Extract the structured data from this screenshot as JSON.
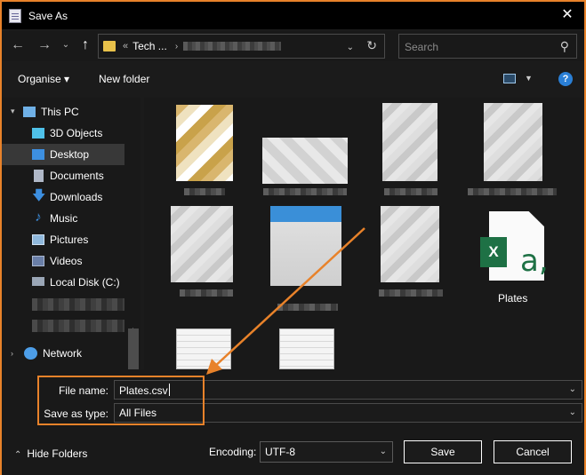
{
  "window": {
    "title": "Save As",
    "close_glyph": "✕"
  },
  "nav_buttons": {
    "back": "←",
    "forward": "→",
    "recent": "⌄",
    "up": "↑"
  },
  "address": {
    "prefix": "«",
    "segment": "Tech ...",
    "chevron": "›",
    "refresh_glyph": "↻",
    "dropdown_glyph": "⌄"
  },
  "search": {
    "placeholder": "Search",
    "icon": "search-icon",
    "glyph": "⚲"
  },
  "toolbar": {
    "organise": "Organise ▾",
    "new_folder": "New folder",
    "help": "?"
  },
  "sidebar": {
    "items": [
      {
        "label": "This PC",
        "icon": "pc-icon",
        "color": "#6fb0e6"
      },
      {
        "label": "3D Objects",
        "icon": "cube-icon",
        "color": "#4fc1e9"
      },
      {
        "label": "Desktop",
        "icon": "desktop-icon",
        "color": "#3d8fe0",
        "selected": true
      },
      {
        "label": "Documents",
        "icon": "documents-icon",
        "color": "#b0b8c8"
      },
      {
        "label": "Downloads",
        "icon": "download-icon",
        "color": "#3d8fe0"
      },
      {
        "label": "Music",
        "icon": "music-icon",
        "color": "#3d8fe0"
      },
      {
        "label": "Pictures",
        "icon": "pictures-icon",
        "color": "#8fb8dc"
      },
      {
        "label": "Videos",
        "icon": "videos-icon",
        "color": "#6a7fa8"
      },
      {
        "label": "Local Disk (C:)",
        "icon": "disk-icon",
        "color": "#9aa6b6"
      },
      {
        "label": "Network",
        "icon": "network-icon",
        "color": "#4d9ee8"
      }
    ]
  },
  "files": {
    "visible_label": "Plates",
    "excel_letter": "X",
    "excel_glyph": "a,"
  },
  "form": {
    "file_name_label": "File name:",
    "file_name_value": "Plates.csv",
    "save_type_label": "Save as type:",
    "save_type_value": "All Files",
    "dropdown_glyph": "⌄"
  },
  "footer": {
    "hide_folders": "Hide Folders",
    "encoding_label": "Encoding:",
    "encoding_value": "UTF-8",
    "save": "Save",
    "cancel": "Cancel"
  },
  "colors": {
    "annotation": "#e8822a",
    "excel_green": "#1e7145",
    "accent": "#2a7fd6"
  }
}
